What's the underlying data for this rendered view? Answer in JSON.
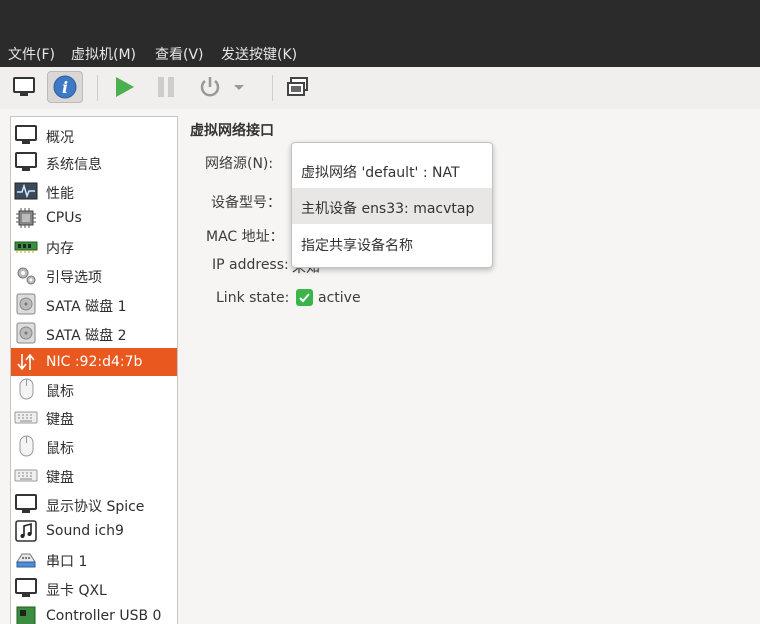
{
  "menubar": {
    "file": "文件(F)",
    "vm": "虚拟机(M)",
    "view": "查看(V)",
    "sendkey": "发送按键(K)"
  },
  "toolbar": {
    "buttons": [
      "console-icon",
      "info-icon",
      "play-icon",
      "pause-icon",
      "power-icon",
      "dropdown-arrow-icon",
      "screenshot-icon"
    ],
    "accent_green": "#4caf50"
  },
  "sidebar": {
    "items": [
      {
        "label": "概况",
        "icon": "monitor-icon"
      },
      {
        "label": "系统信息",
        "icon": "monitor-icon"
      },
      {
        "label": "性能",
        "icon": "performance-graph-icon"
      },
      {
        "label": "CPUs",
        "icon": "cpu-chip-icon"
      },
      {
        "label": "内存",
        "icon": "memory-module-icon"
      },
      {
        "label": "引导选项",
        "icon": "gears-icon"
      },
      {
        "label": "SATA 磁盘 1",
        "icon": "disk-icon"
      },
      {
        "label": "SATA 磁盘 2",
        "icon": "disk-icon"
      },
      {
        "label": "NIC :92:d4:7b",
        "icon": "network-arrows-icon"
      },
      {
        "label": "鼠标",
        "icon": "mouse-icon"
      },
      {
        "label": "键盘",
        "icon": "keyboard-icon"
      },
      {
        "label": "鼠标",
        "icon": "mouse-icon"
      },
      {
        "label": "键盘",
        "icon": "keyboard-icon"
      },
      {
        "label": "显示协议 Spice",
        "icon": "monitor-icon"
      },
      {
        "label": "Sound ich9",
        "icon": "music-note-icon"
      },
      {
        "label": "串口 1",
        "icon": "serial-port-icon"
      },
      {
        "label": "显卡 QXL",
        "icon": "monitor-icon"
      },
      {
        "label": "Controller USB 0",
        "icon": "controller-card-icon"
      }
    ],
    "selected_color": "#e9591f"
  },
  "detail": {
    "title": "虚拟网络接口",
    "network_source_label": "网络源(N):",
    "device_model_label": "设备型号：",
    "mac_label": "MAC 地址：",
    "ip_label": "IP address:",
    "ip_value_partial": "未知",
    "link_state_label": "Link state:",
    "link_state_value": "active"
  },
  "dropdown": {
    "options": [
      "虚拟网络 'default' : NAT",
      "主机设备 ens33: macvtap",
      "指定共享设备名称"
    ],
    "highlighted": "主机设备 ens33: macvtap"
  }
}
